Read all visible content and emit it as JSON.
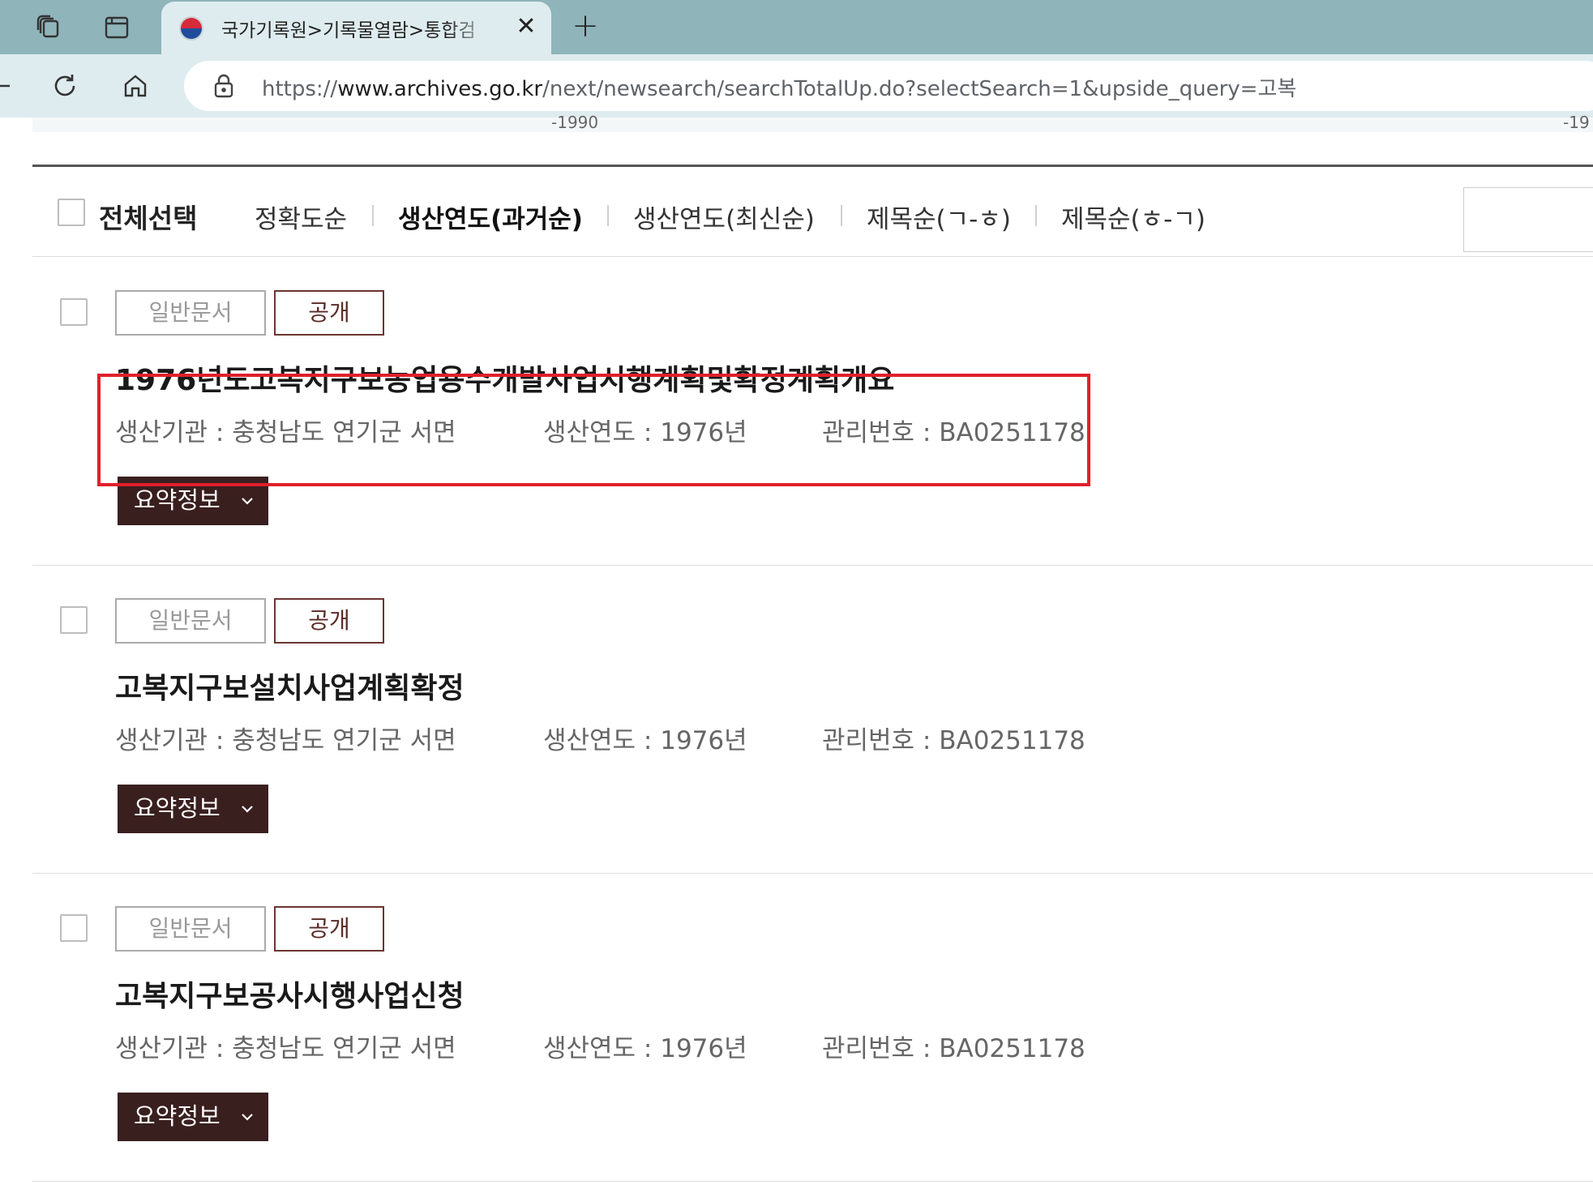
{
  "browser": {
    "tab": {
      "title": "국가기록원>기록물열람>통합검",
      "close_label": "✕"
    },
    "new_tab_label": "+",
    "url": {
      "scheme": "https://",
      "host": "www.archives.go.kr",
      "path": "/next/newsearch/searchTotalUp.do?selectSearch=1&upside_query=고복"
    }
  },
  "timeline": {
    "labels": [
      "-1990",
      "-19"
    ]
  },
  "sortbar": {
    "select_all_label": "전체선택",
    "options": [
      {
        "label": "정확도순",
        "active": false
      },
      {
        "label": "생산연도(과거순)",
        "active": true
      },
      {
        "label": "생산연도(최신순)",
        "active": false
      },
      {
        "label": "제목순(ㄱ-ㅎ)",
        "active": false
      },
      {
        "label": "제목순(ㅎ-ㄱ)",
        "active": false
      }
    ]
  },
  "results": [
    {
      "type_badge": "일반문서",
      "status_badge": "공개",
      "title": "1976년도고복지구보농업용수개발사업시행계획및확정계획개요",
      "producer": "생산기관 : 충청남도 연기군 서면",
      "year": "생산연도 : 1976년",
      "mgmt_no": "관리번호 : BA0251178",
      "summary_label": "요약정보"
    },
    {
      "type_badge": "일반문서",
      "status_badge": "공개",
      "title": "고복지구보설치사업계획확정",
      "producer": "생산기관 : 충청남도 연기군 서면",
      "year": "생산연도 : 1976년",
      "mgmt_no": "관리번호 : BA0251178",
      "summary_label": "요약정보"
    },
    {
      "type_badge": "일반문서",
      "status_badge": "공개",
      "title": "고복지구보공사시행사업신청",
      "producer": "생산기관 : 충청남도 연기군 서면",
      "year": "생산연도 : 1976년",
      "mgmt_no": "관리번호 : BA0251178",
      "summary_label": "요약정보"
    }
  ],
  "colors": {
    "tabstrip": "#8fb4ba",
    "toolbar": "#dfecef",
    "badge_open_border": "#6b3530",
    "summary_button": "#3a1f1f",
    "highlight": "#e0202b"
  }
}
